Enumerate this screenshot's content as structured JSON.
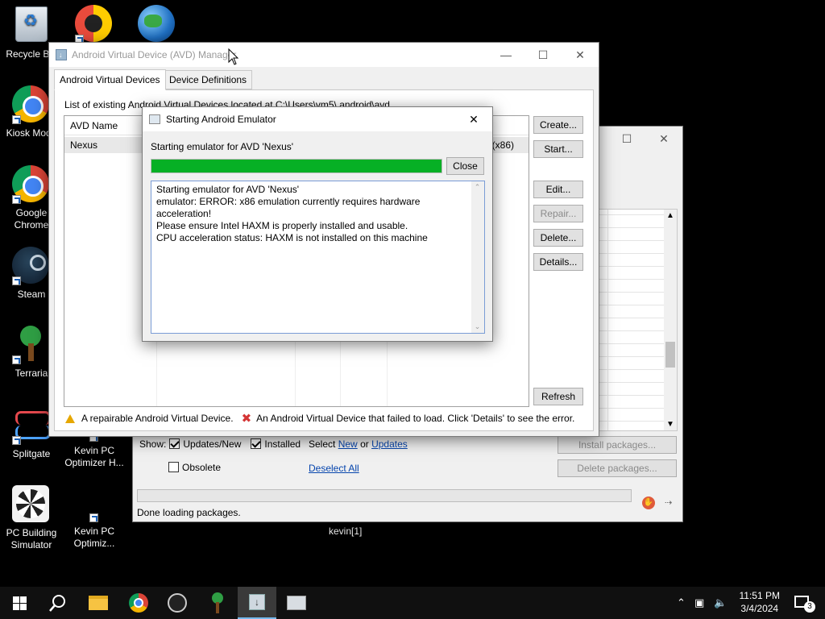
{
  "desktop": {
    "icons": [
      {
        "label": "Recycle Bin"
      },
      {
        "label": "Kiosk Mode"
      },
      {
        "label": "Google Chrome"
      },
      {
        "label": "Steam"
      },
      {
        "label": "Terraria"
      },
      {
        "label": "Splitgate"
      },
      {
        "label": "PC Building Simulator"
      },
      {
        "label": "Kevin PC Optimizer H..."
      },
      {
        "label": "Kevin PC Optimiz..."
      }
    ],
    "kevin_label": "kevin[1]"
  },
  "sdk_manager": {
    "show_label": "Show:",
    "updates_new_label": "Updates/New",
    "installed_label": "Installed",
    "obsolete_label": "Obsolete",
    "select_label": "Select",
    "new_link": "New",
    "or_label": "or",
    "updates_link": "Updates",
    "deselect_all_link": "Deselect All",
    "install_button": "Install packages...",
    "delete_button": "Delete packages...",
    "status": "Done loading packages.",
    "checkboxes": {
      "updates_new": true,
      "installed": true,
      "obsolete": false
    }
  },
  "avd_manager": {
    "title": "Android Virtual Device (AVD) Manager",
    "tabs": [
      "Android Virtual Devices",
      "Device Definitions"
    ],
    "list_caption": "List of existing Android Virtual Devices located at C:\\Users\\vm5\\.android\\avd",
    "column_header": "AVD Name",
    "rows": [
      {
        "name": "Nexus",
        "trailing": "(x86)"
      }
    ],
    "buttons": {
      "create": "Create...",
      "start": "Start...",
      "edit": "Edit...",
      "repair": "Repair...",
      "delete": "Delete...",
      "details": "Details...",
      "refresh": "Refresh"
    },
    "legend_repairable": "A repairable Android Virtual Device.",
    "legend_failed": "An Android Virtual Device that failed to load. Click 'Details' to see the error."
  },
  "emulator_dialog": {
    "title": "Starting Android Emulator",
    "status": "Starting emulator for AVD 'Nexus'",
    "progress": 1.0,
    "close_button": "Close",
    "log_lines": [
      "Starting emulator for AVD 'Nexus'",
      "emulator: ERROR: x86 emulation currently requires hardware",
      "acceleration!",
      "Please ensure Intel HAXM is properly installed and usable.",
      "CPU acceleration status: HAXM is not installed on this machine"
    ]
  },
  "taskbar": {
    "time": "11:51 PM",
    "date": "3/4/2024",
    "notification_count": "3",
    "accent_color": "#76b9ed"
  }
}
